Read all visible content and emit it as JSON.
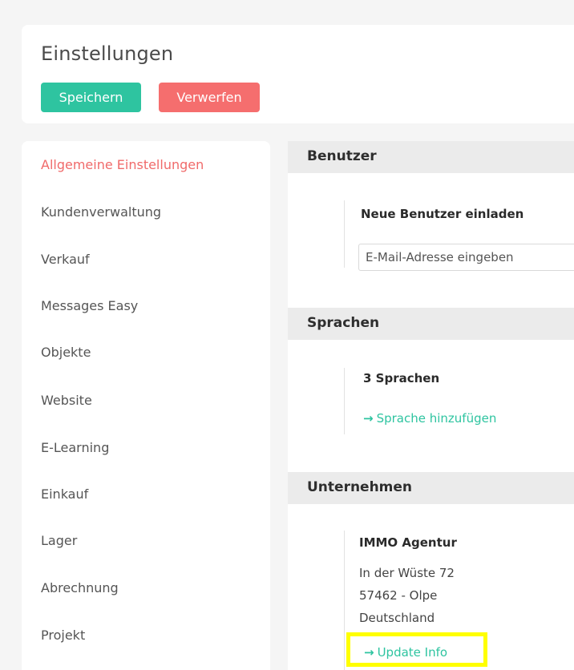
{
  "header": {
    "title": "Einstellungen",
    "save_label": "Speichern",
    "discard_label": "Verwerfen"
  },
  "colors": {
    "save_button": "#2ec4a0",
    "discard_button": "#f56e6e",
    "active_nav": "#f06a6a",
    "link": "#2ec4a0",
    "highlight": "#ffff00"
  },
  "sidebar": {
    "items": [
      {
        "label": "Allgemeine Einstellungen",
        "active": true
      },
      {
        "label": "Kundenverwaltung"
      },
      {
        "label": "Verkauf"
      },
      {
        "label": "Messages Easy"
      },
      {
        "label": "Objekte"
      },
      {
        "label": "Website"
      },
      {
        "label": "E-Learning"
      },
      {
        "label": "Einkauf"
      },
      {
        "label": "Lager"
      },
      {
        "label": "Abrechnung"
      },
      {
        "label": "Projekt"
      }
    ]
  },
  "sections": {
    "users": {
      "title": "Benutzer",
      "invite_label": "Neue Benutzer einladen",
      "email_placeholder": "E-Mail-Adresse eingeben"
    },
    "languages": {
      "title": "Sprachen",
      "count_label": "3 Sprachen",
      "add_link": "Sprache hinzufügen"
    },
    "company": {
      "title": "Unternehmen",
      "name": "IMMO Agentur",
      "street": "In der Wüste 72",
      "city": "57462 - Olpe",
      "country": "Deutschland",
      "update_link": "Update Info"
    }
  },
  "icons": {
    "arrow": "→"
  }
}
